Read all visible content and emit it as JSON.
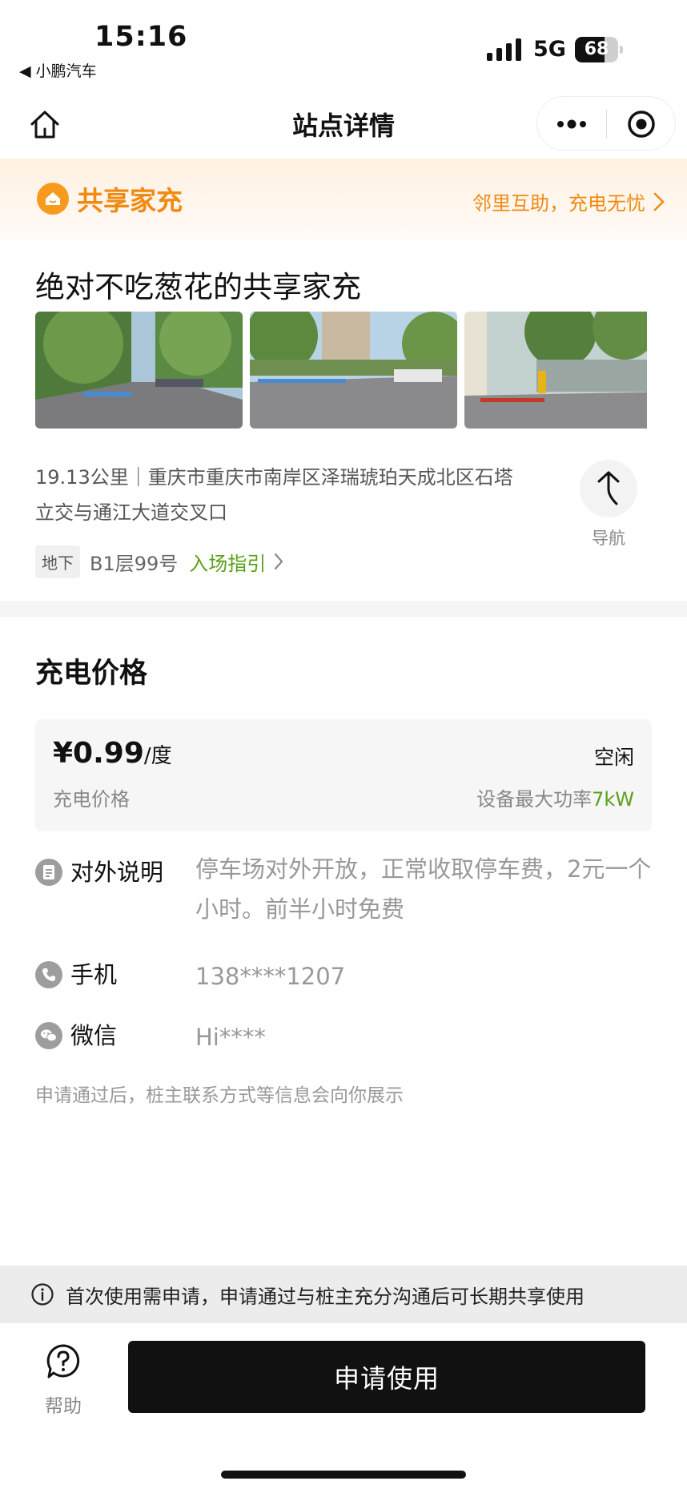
{
  "status_bar": {
    "time": "15:16",
    "back_app": "◀ 小鹏汽车",
    "network": "5G",
    "battery_level": 68,
    "battery": "68"
  },
  "nav": {
    "title": "站点详情"
  },
  "banner": {
    "title": "共享家充",
    "link_text": "邻里互助，充电无忧"
  },
  "station": {
    "name": "绝对不吃葱花的共享家充",
    "address": "19.13公里｜重庆市重庆市南岸区泽瑞琥珀天成北区石塔立交与通江大道交叉口",
    "navigate_label": "导航",
    "floor_tag": "地下",
    "floor": "B1层99号",
    "guide_link": "入场指引"
  },
  "pricing": {
    "section_title": "充电价格",
    "price": "¥0.99",
    "unit": "/度",
    "price_label": "充电价格",
    "status": "空闲",
    "power_label": "设备最大功率",
    "power_value": "7kW"
  },
  "info": {
    "description_label": "对外说明",
    "description_value": "停车场对外开放，正常收取停车费，2元一个小时。前半小时免费",
    "phone_label": "手机",
    "phone_value": "138****1207",
    "wechat_label": "微信",
    "wechat_value": "Hi****"
  },
  "apply_hint": "申请通过后，桩主联系方式等信息会向你展示",
  "notice": "首次使用需申请，申请通过与桩主充分沟通后可长期共享使用",
  "bottom": {
    "help_label": "帮助",
    "apply_button": "申请使用"
  },
  "colors": {
    "brand_orange": "#f08a12",
    "accent_green": "#5aa21a",
    "button_black": "#111111"
  }
}
